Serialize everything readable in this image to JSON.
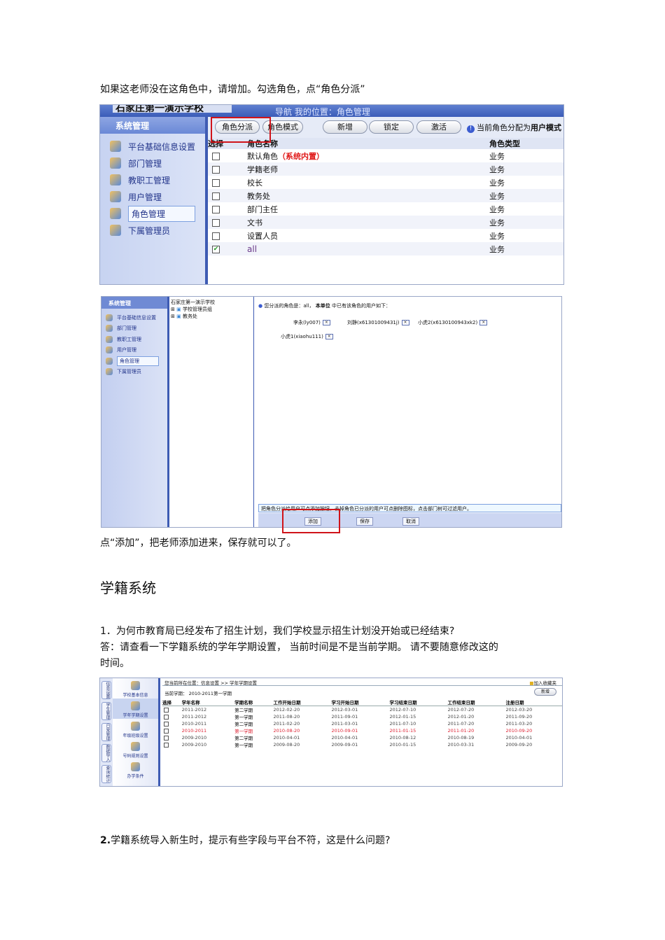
{
  "intro": "如果这老师没在这角色中，请增加。勾选角色，点“角色分派”",
  "shot1": {
    "school": "石家庄第一演示学校",
    "location": "导航   我的位置：角色管理",
    "sidebar_title": "系统管理",
    "sidebar": [
      "平台基础信息设置",
      "部门管理",
      "教职工管理",
      "用户管理",
      "角色管理",
      "下属管理员"
    ],
    "buttons": [
      "角色分派",
      "角色模式",
      "新增",
      "锁定",
      "激活"
    ],
    "hint_prefix": "当前角色分配为",
    "hint_bold": "用户模式",
    "columns": [
      "选择",
      "角色名称",
      "角色类型"
    ],
    "rows": [
      {
        "name": "默认角色",
        "tag": "（系统内置）",
        "type": "业务",
        "checked": false
      },
      {
        "name": "学籍老师",
        "tag": "",
        "type": "业务",
        "checked": false
      },
      {
        "name": "校长",
        "tag": "",
        "type": "业务",
        "checked": false
      },
      {
        "name": "教务处",
        "tag": "",
        "type": "业务",
        "checked": false
      },
      {
        "name": "部门主任",
        "tag": "",
        "type": "业务",
        "checked": false
      },
      {
        "name": "文书",
        "tag": "",
        "type": "业务",
        "checked": false
      },
      {
        "name": "设置人员",
        "tag": "",
        "type": "业务",
        "checked": false
      },
      {
        "name": "all",
        "tag": "",
        "type": "业务",
        "checked": true
      }
    ]
  },
  "shot2": {
    "sidebar_title": "系统管理",
    "sidebar": [
      "平台基础信息设置",
      "部门管理",
      "教职工管理",
      "用户管理",
      "角色管理",
      "下属管理员"
    ],
    "tree": [
      "石家庄第一演示学校",
      "学校管理员组",
      "教务处"
    ],
    "info_a": "您分派的角色是：all，",
    "info_b": "本单位",
    "info_c": "中已有该角色的用户如下：",
    "users": [
      "李永(ly007)",
      "刘静(x61301009431j)",
      "小虎2(x6130100943xk2)",
      "小虎1(xiaohu111)"
    ],
    "remove_icon": "×",
    "tip": "把角色分派给用户可点添加按钮，去掉角色已分派的用户可点删除图标，点击部门树可过滤用户。",
    "buttons": [
      "添加",
      "保存",
      "取消"
    ]
  },
  "after": "点“添加”，把老师添加进来，保存就可以了。",
  "heading": "学籍系统",
  "q1": "1．为何市教育局已经发布了招生计划，我们学校显示招生计划没开始或已经结束?",
  "a1_line1": "答：请查看一下学籍系统的学年学期设置，        当前时间是不是当前学期。     请不要随意修改这的",
  "a1_line2": "时间。",
  "shot3": {
    "tabs": [
      "信息设置",
      "学生管理",
      "日常管理",
      "数据导入",
      "查询统计"
    ],
    "nav": [
      "学校基本信息",
      "学年学期设置",
      "年级班级设置",
      "号码规则设置",
      "办学条件"
    ],
    "breadcrumb": "您当前所在位置：信息设置 >> 学年学期设置",
    "favorite": "加入收藏夹",
    "current_label": "当前学期：",
    "current_value": "2010-2011第一学期",
    "new_button": "新增",
    "columns": [
      "选择",
      "学年名称",
      "学期名称",
      "工作开始日期",
      "学习开始日期",
      "学习结束日期",
      "工作结束日期",
      "注册日期"
    ],
    "rows": [
      [
        "2011-2012",
        "第二学期",
        "2012-02-20",
        "2012-03-01",
        "2012-07-10",
        "2012-07-20",
        "2012-03-20"
      ],
      [
        "2011-2012",
        "第一学期",
        "2011-08-20",
        "2011-09-01",
        "2012-01-15",
        "2012-01-20",
        "2011-09-20"
      ],
      [
        "2010-2011",
        "第二学期",
        "2011-02-20",
        "2011-03-01",
        "2011-07-10",
        "2011-07-20",
        "2011-03-20"
      ],
      [
        "2010-2011",
        "第一学期",
        "2010-08-20",
        "2010-09-01",
        "2011-01-15",
        "2011-01-20",
        "2010-09-20"
      ],
      [
        "2009-2010",
        "第二学期",
        "2010-04-01",
        "2010-04-01",
        "2010-08-12",
        "2010-08-19",
        "2010-04-01"
      ],
      [
        "2009-2010",
        "第一学期",
        "2009-08-20",
        "2009-09-01",
        "2010-01-15",
        "2010-03-31",
        "2009-09-20"
      ]
    ],
    "highlight_row": 3
  },
  "q2_num": "2.",
  "q2": "学籍系统导入新生时，提示有些字段与平台不符，这是什么问题?",
  "colors": {
    "accent": "#3e5bb3",
    "red": "#d0141a"
  }
}
